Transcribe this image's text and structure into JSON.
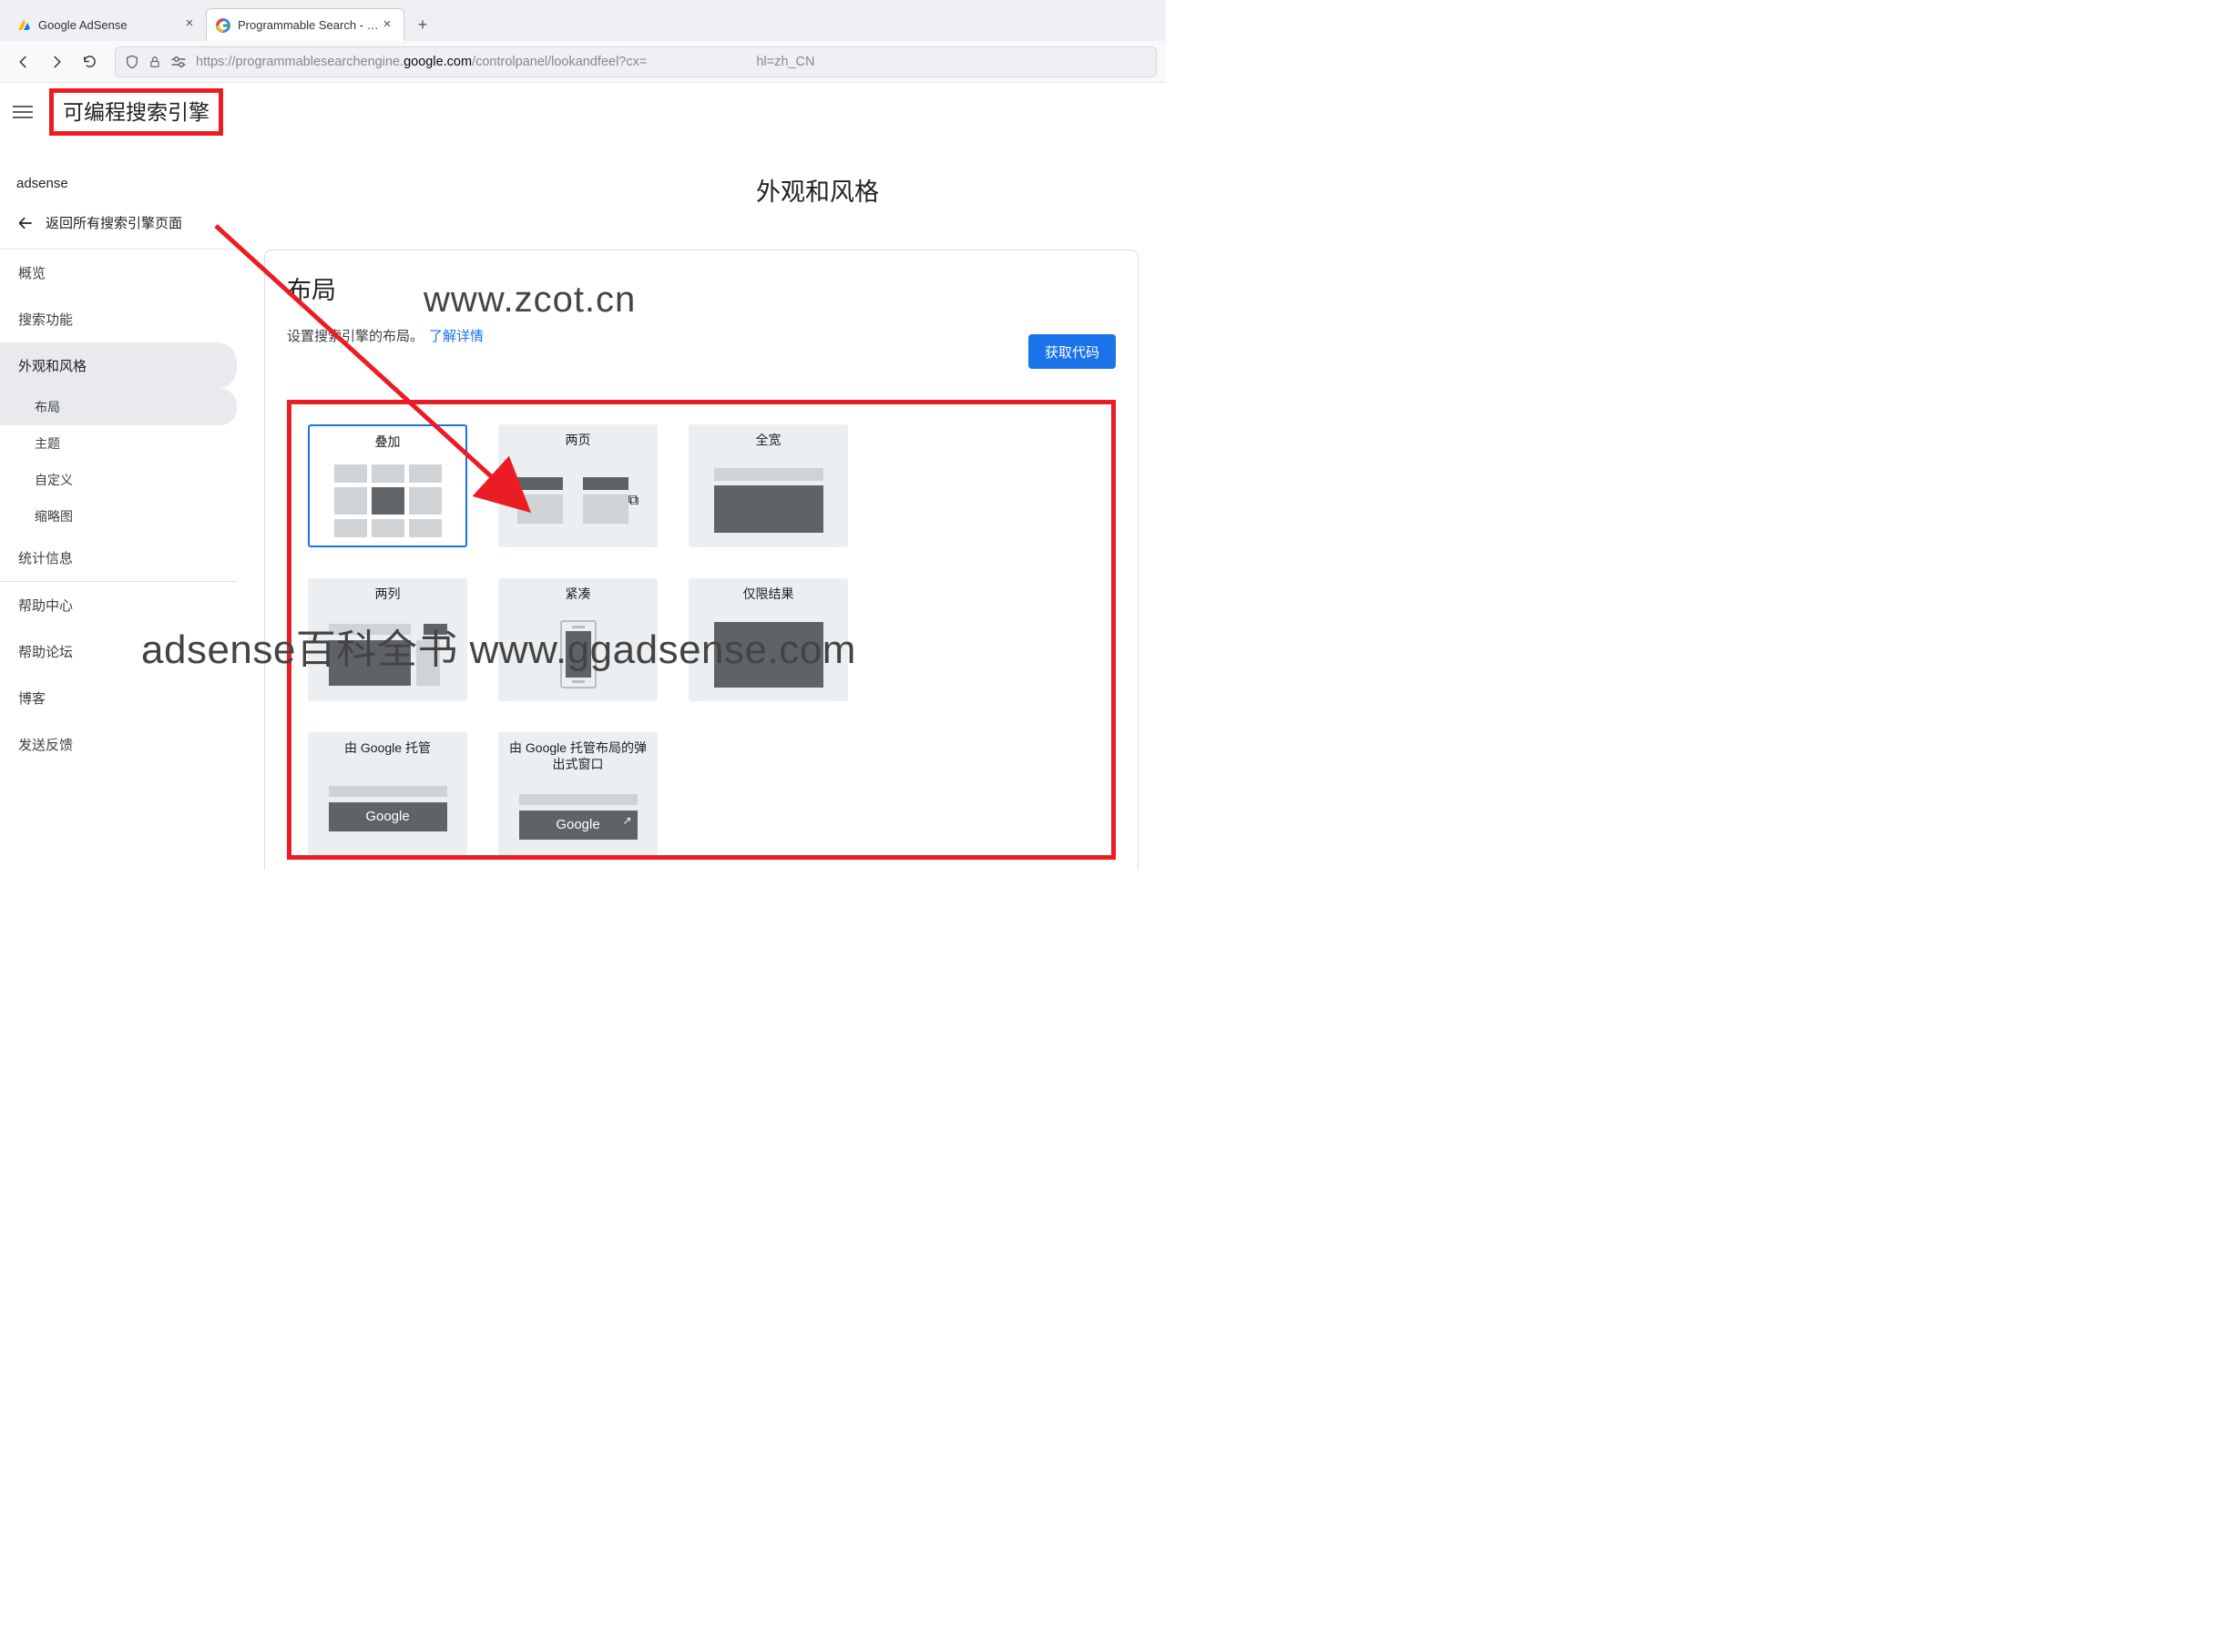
{
  "tabs": [
    {
      "title": "Google AdSense"
    },
    {
      "title": "Programmable Search - Loo"
    }
  ],
  "url": {
    "pre": "https://programmablesearchengine.",
    "domain": "google.com",
    "post": "/controlpanel/lookandfeel?cx=",
    "tail": "hl=zh_CN"
  },
  "brand": "可编程搜索引擎",
  "sidebar": {
    "title": "adsense",
    "back": "返回所有搜索引擎页面",
    "items": {
      "overview": "概览",
      "search": "搜索功能",
      "look": "外观和风格",
      "subLayout": "布局",
      "subTheme": "主题",
      "subCustom": "自定义",
      "subThumb": "缩略图",
      "stats": "统计信息",
      "help": "帮助中心",
      "forum": "帮助论坛",
      "blog": "博客",
      "feedback": "发送反馈"
    }
  },
  "content": {
    "pageTitle": "外观和风格",
    "cardTitle": "布局",
    "cardDesc": "设置搜索引擎的布局。",
    "learnMore": "了解详情",
    "getCode": "获取代码",
    "options": {
      "overlay": "叠加",
      "twoPage": "两页",
      "fullWidth": "全宽",
      "twoCol": "两列",
      "compact": "紧凑",
      "resultsOnly": "仅限结果",
      "hosted": "由 Google 托管",
      "hostedPopup": "由 Google 托管布局的弹出式窗口"
    },
    "googleWord": "Google"
  },
  "watermarks": {
    "w1": "www.zcot.cn",
    "w2": "adsense百科全书 www.ggadsense.com"
  }
}
